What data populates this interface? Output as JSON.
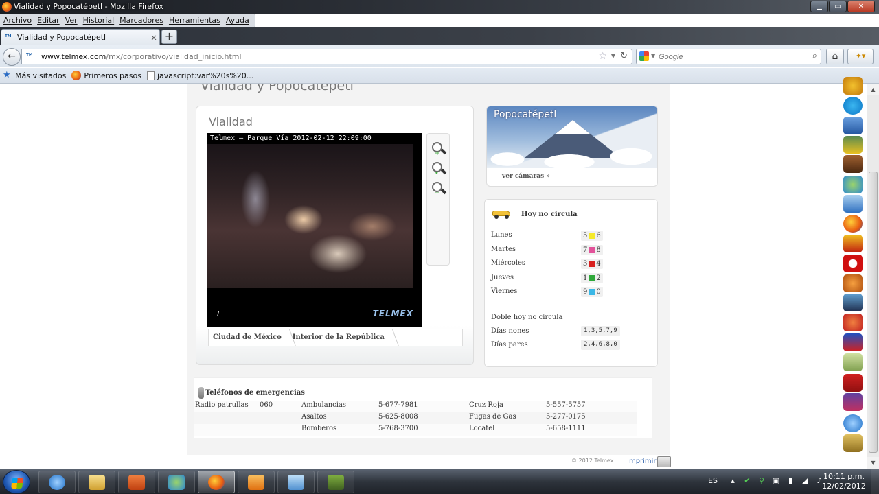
{
  "window": {
    "title": "Vialidad y Popocatépetl - Mozilla Firefox"
  },
  "menu": [
    "Archivo",
    "Editar",
    "Ver",
    "Historial",
    "Marcadores",
    "Herramientas",
    "Ayuda"
  ],
  "tab": {
    "title": "Vialidad y Popocatépetl",
    "close": "×",
    "new": "+"
  },
  "nav": {
    "back": "←",
    "url_domain": "www.telmex.com",
    "url_path": "/mx/corporativo/vialidad_inicio.html",
    "search_placeholder": "Google",
    "home": "⌂"
  },
  "bookmarks": [
    "Más visitados",
    "Primeros pasos",
    "javascript:var%20s%20..."
  ],
  "page": {
    "heading": "Vialidad y Popocatépetl",
    "vialidad_title": "Vialidad",
    "camera_caption": "Telmex – Parque Vía 2012-02-12 22:09:00",
    "camera_slash": "/",
    "camera_logo": "TELMEX",
    "location_tabs": [
      "Ciudad de México",
      "Interior de la República"
    ],
    "popo_title": "Popocatépetl",
    "popo_link": "ver cámaras »",
    "hnc_title": "Hoy no circula",
    "days": [
      {
        "day": "Lunes",
        "a": "5",
        "b": "6",
        "color": "#f5e92a"
      },
      {
        "day": "Martes",
        "a": "7",
        "b": "8",
        "color": "#e2529a"
      },
      {
        "day": "Miércoles",
        "a": "3",
        "b": "4",
        "color": "#d8201f"
      },
      {
        "day": "Jueves",
        "a": "1",
        "b": "2",
        "color": "#2fa83a"
      },
      {
        "day": "Viernes",
        "a": "9",
        "b": "0",
        "color": "#3bb7e6"
      }
    ],
    "doble_title": "Doble hoy no circula",
    "doble": [
      {
        "label": "Días nones",
        "value": "1,3,5,7,9"
      },
      {
        "label": "Días pares",
        "value": "2,4,6,8,0"
      }
    ],
    "emergency_title": "Teléfonos de emergencias",
    "emergency": [
      [
        "Radio patrullas",
        "060",
        "Ambulancias",
        "5-677-7981",
        "Cruz Roja",
        "5-557-5757"
      ],
      [
        "",
        "",
        "Asaltos",
        "5-625-8008",
        "Fugas de Gas",
        "5-277-0175"
      ],
      [
        "",
        "",
        "Bomberos",
        "5-768-3700",
        "Locatel",
        "5-658-1111"
      ]
    ],
    "copyright": "© 2012 Telmex.",
    "print": "Imprimir"
  },
  "taskbar": {
    "lang": "ES",
    "time": "10:11 p.m.",
    "date": "12/02/2012"
  }
}
